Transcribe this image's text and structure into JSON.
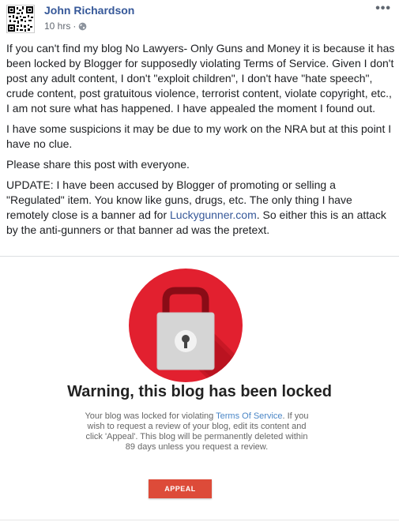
{
  "post": {
    "author": "John Richardson",
    "time": "10 hrs",
    "separator": "·",
    "more_label": "•••",
    "paragraphs": {
      "p1": "If you can't find my blog No Lawyers- Only Guns and Money it is because it has been locked by Blogger for supposedly violating Terms of Service. Given I don't post any adult content, I don't \"exploit children\", I don't have \"hate speech\", crude content, post gratuitous violence, terrorist content, violate copyright, etc., I am not sure what has happened. I have appealed the moment I found out.",
      "p2": "I have some suspicions it may be due to my work on the NRA but at this point I have no clue.",
      "p3": "Please share this post with everyone.",
      "p4_before": "UPDATE: I have been accused by Blogger of promoting or selling a \"Regulated\" item. You know like guns, drugs, etc. The only thing I have remotely close is a banner ad for ",
      "p4_link": "Luckygunner.com",
      "p4_after": ". So either this is an attack by the anti-gunners or that banner ad was the pretext."
    }
  },
  "banner": {
    "title": "Warning, this blog has been locked",
    "body_before": "Your blog was locked for violating ",
    "body_link": "Terms Of Service",
    "body_after": ". If you wish to request a review of your blog, edit its content and click 'Appeal'. This blog will be permanently deleted within 89 days unless you request a review.",
    "button_label": "APPEAL"
  },
  "colors": {
    "author_link": "#365899",
    "lock_red": "#e2202f",
    "appeal_button": "#dd4b39",
    "tos_link": "#4a86c6"
  },
  "icons": {
    "avatar": "qr-code-avatar",
    "privacy": "globe-icon",
    "menu": "more-options-icon",
    "lock": "padlock-icon"
  }
}
